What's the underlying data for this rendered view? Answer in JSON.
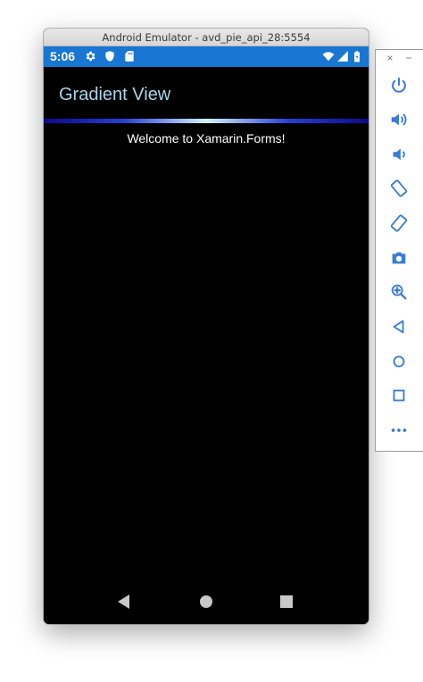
{
  "window": {
    "title": "Android Emulator - avd_pie_api_28:5554"
  },
  "statusbar": {
    "time": "5:06",
    "left_icons": [
      "gear-icon",
      "shield-icon",
      "sd-card-icon"
    ],
    "right_icons": [
      "wifi-icon",
      "signal-icon",
      "battery-icon"
    ],
    "color": "#1976d2"
  },
  "app": {
    "title": "Gradient View",
    "title_color": "#a9d6e8",
    "welcome_text": "Welcome to Xamarin.Forms!"
  },
  "navbar": {
    "buttons": [
      "back-icon",
      "home-icon",
      "recents-icon"
    ]
  },
  "side_toolbar": {
    "close_label": "×",
    "minimize_label": "−",
    "tools": [
      "power-icon",
      "volume-up-icon",
      "volume-down-icon",
      "rotate-left-icon",
      "rotate-right-icon",
      "camera-icon",
      "zoom-icon",
      "back-icon",
      "home-icon",
      "overview-icon",
      "more-icon"
    ],
    "icon_color": "#3a7bd5"
  }
}
